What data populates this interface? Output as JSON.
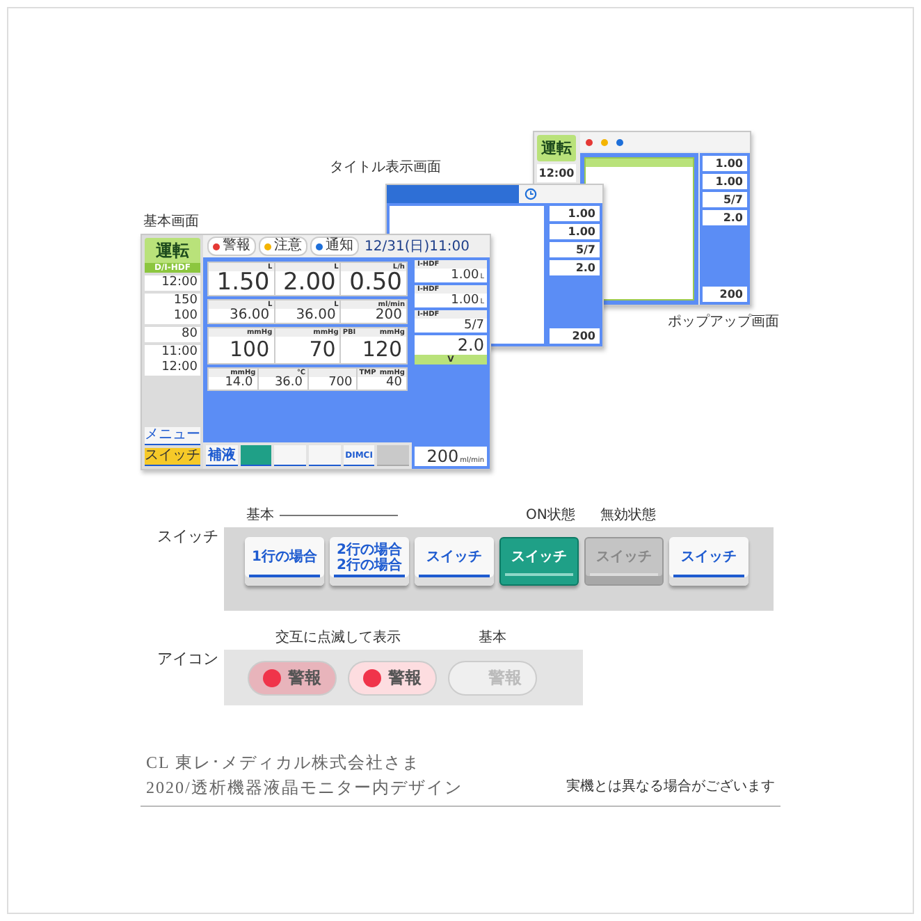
{
  "captions": {
    "basic": "基本画面",
    "title": "タイトル表示画面",
    "popup": "ポップアップ画面"
  },
  "main_screen": {
    "status": "運転",
    "mode": "D/I-HDF",
    "alerts": [
      {
        "label": "警報",
        "color": "#e53935"
      },
      {
        "label": "注意",
        "color": "#f4b400"
      },
      {
        "label": "通知",
        "color": "#1e6fd9"
      }
    ],
    "clock": "12/31(日)11:00",
    "left_cards": [
      {
        "values": [
          "12:00"
        ]
      },
      {
        "values": [
          "150",
          "100"
        ]
      },
      {
        "values": [
          "80"
        ]
      },
      {
        "values": [
          "11:00",
          "12:00"
        ]
      }
    ],
    "rows": [
      {
        "cells": [
          {
            "unit": "L",
            "value": "1.50"
          },
          {
            "unit": "L",
            "value": "2.00"
          },
          {
            "unit": "L/h",
            "value": "0.50"
          }
        ]
      },
      {
        "cells": [
          {
            "unit": "L",
            "value": "36.00"
          },
          {
            "unit": "L",
            "value": "36.00"
          },
          {
            "unit": "ml/min",
            "value": "200"
          }
        ]
      },
      {
        "cells": [
          {
            "unit": "mmHg",
            "value": "100"
          },
          {
            "unit": "mmHg",
            "value": "70"
          },
          {
            "label": "PBI",
            "unit": "mmHg",
            "value": "120"
          }
        ]
      },
      {
        "cells": [
          {
            "unit": "mmHg",
            "value": "14.0"
          },
          {
            "unit": "℃",
            "value": "36.0"
          },
          {
            "value": "700"
          },
          {
            "label": "TMP",
            "unit": "mmHg",
            "value": "40"
          }
        ]
      }
    ],
    "right_cards": [
      {
        "label": "I-HDF",
        "value": "1.00",
        "unit": "L"
      },
      {
        "label": "I-HDF",
        "value": "1.00",
        "unit": "L"
      },
      {
        "label": "I-HDF",
        "value": "5/7"
      }
    ],
    "syringe": {
      "value": "2.0",
      "status": "V"
    },
    "flow": {
      "value": "200",
      "unit": "ml/min"
    },
    "left_buttons": [
      {
        "label": "メニュー",
        "selected": false
      },
      {
        "label": "スイッチ",
        "selected": true
      }
    ],
    "tabs": [
      {
        "label": "補液",
        "selected": false,
        "disabled": false
      },
      {
        "selected": true,
        "disabled": false
      },
      {
        "selected": false,
        "disabled": false
      },
      {
        "selected": false,
        "disabled": false
      },
      {
        "label": "DIMCI",
        "selected": false,
        "disabled": false
      },
      {
        "selected": false,
        "disabled": true
      }
    ]
  },
  "title_screen": {
    "values": [
      "1.00",
      "1.00",
      "5/7",
      "2.0",
      "200"
    ]
  },
  "popup_screen": {
    "status": "運転",
    "time": "12:00",
    "values": [
      "1.00",
      "1.00",
      "5/7",
      "2.0",
      "200"
    ]
  },
  "switch_section": {
    "label": "スイッチ",
    "headings": [
      "基本",
      "ON状態",
      "無効状態"
    ],
    "switches": [
      {
        "label": "1行の場合",
        "selected": false,
        "disabled": false
      },
      {
        "label": "2行の場合\n2行の場合",
        "selected": false,
        "disabled": false
      },
      {
        "label": "スイッチ",
        "selected": false,
        "disabled": false
      },
      {
        "label": "スイッチ",
        "selected": true,
        "disabled": false
      },
      {
        "label": "スイッチ",
        "selected": false,
        "disabled": true
      },
      {
        "label": "スイッチ",
        "selected": false,
        "disabled": false
      }
    ]
  },
  "icon_section": {
    "label": "アイコン",
    "headings": [
      "交互に点滅して表示",
      "基本"
    ],
    "alarms": [
      {
        "label": "警報",
        "kind": "dark"
      },
      {
        "label": "警報",
        "kind": "light"
      },
      {
        "label": "警報",
        "kind": "off"
      }
    ]
  },
  "footer": {
    "lines": [
      "CL 東レ･メディカル株式会社さま",
      "2020/透析機器液晶モニター内デザイン"
    ],
    "note": "実機とは異なる場合がございます"
  }
}
